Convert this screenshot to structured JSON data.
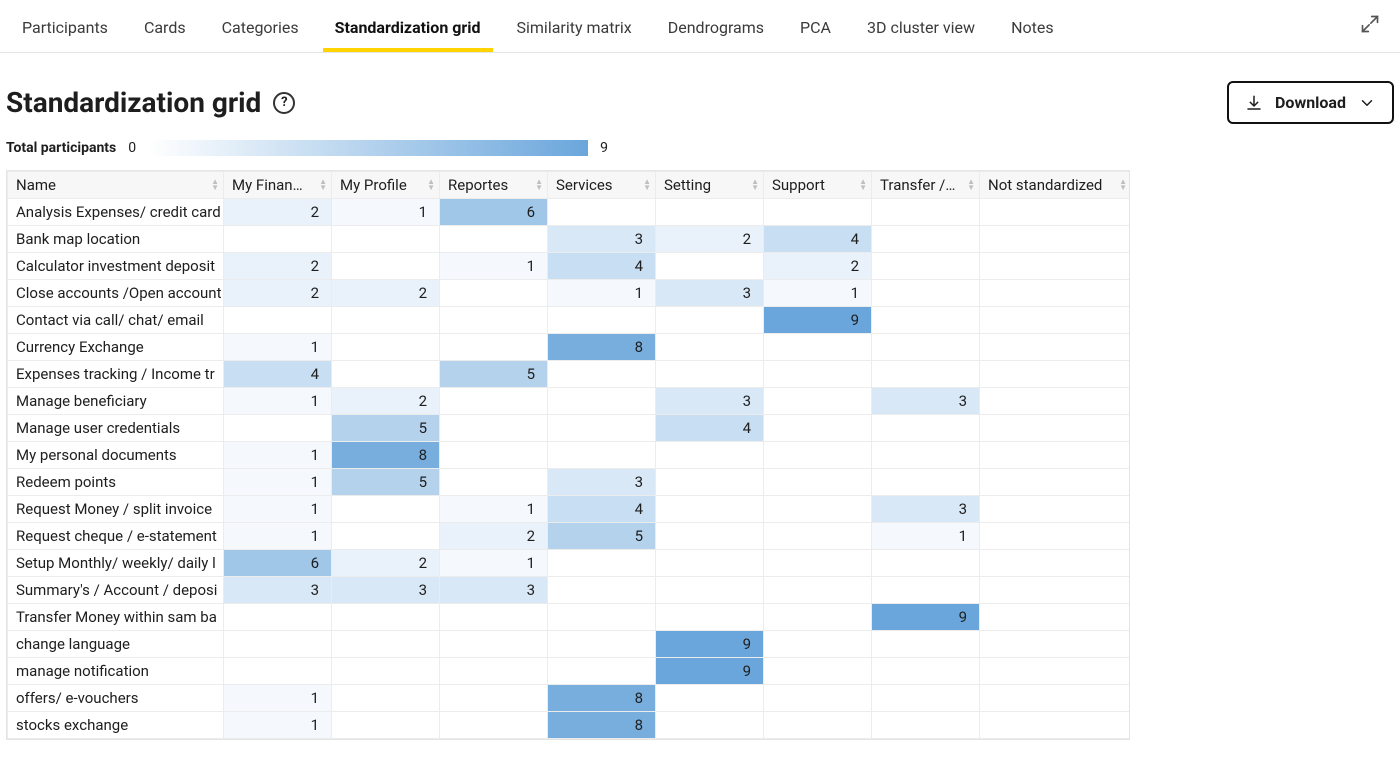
{
  "tabs": {
    "items": [
      "Participants",
      "Cards",
      "Categories",
      "Standardization grid",
      "Similarity matrix",
      "Dendrograms",
      "PCA",
      "3D cluster view",
      "Notes"
    ],
    "activeIndex": 3
  },
  "header": {
    "title": "Standardization grid",
    "download_label": "Download"
  },
  "legend": {
    "label": "Total participants",
    "min": "0",
    "max": "9",
    "maxValue": 9
  },
  "columns": [
    "Name",
    "My Finan…",
    "My Profile",
    "Reportes",
    "Services",
    "Setting",
    "Support",
    "Transfer /…",
    "Not standardized"
  ],
  "rows": [
    {
      "name": "Analysis Expenses/ credit card",
      "cells": [
        2,
        1,
        6,
        null,
        null,
        null,
        null,
        null
      ]
    },
    {
      "name": "Bank map location",
      "cells": [
        null,
        null,
        null,
        3,
        2,
        4,
        null,
        null
      ]
    },
    {
      "name": "Calculator investment deposit",
      "cells": [
        2,
        null,
        1,
        4,
        null,
        2,
        null,
        null
      ]
    },
    {
      "name": "Close accounts /Open account",
      "cells": [
        2,
        2,
        null,
        1,
        3,
        1,
        null,
        null
      ]
    },
    {
      "name": "Contact via call/ chat/ email",
      "cells": [
        null,
        null,
        null,
        null,
        null,
        9,
        null,
        null
      ]
    },
    {
      "name": "Currency Exchange",
      "cells": [
        1,
        null,
        null,
        8,
        null,
        null,
        null,
        null
      ]
    },
    {
      "name": "Expenses tracking / Income tr",
      "cells": [
        4,
        null,
        5,
        null,
        null,
        null,
        null,
        null
      ]
    },
    {
      "name": "Manage beneficiary",
      "cells": [
        1,
        2,
        null,
        null,
        3,
        null,
        3,
        null
      ]
    },
    {
      "name": "Manage user credentials",
      "cells": [
        null,
        5,
        null,
        null,
        4,
        null,
        null,
        null
      ]
    },
    {
      "name": "My personal documents",
      "cells": [
        1,
        8,
        null,
        null,
        null,
        null,
        null,
        null
      ]
    },
    {
      "name": "Redeem points",
      "cells": [
        1,
        5,
        null,
        3,
        null,
        null,
        null,
        null
      ]
    },
    {
      "name": "Request Money / split invoice",
      "cells": [
        1,
        null,
        1,
        4,
        null,
        null,
        3,
        null
      ]
    },
    {
      "name": "Request cheque / e-statement",
      "cells": [
        1,
        null,
        2,
        5,
        null,
        null,
        1,
        null
      ]
    },
    {
      "name": "Setup Monthly/ weekly/ daily l",
      "cells": [
        6,
        2,
        1,
        null,
        null,
        null,
        null,
        null
      ]
    },
    {
      "name": "Summary's / Account / deposi",
      "cells": [
        3,
        3,
        3,
        null,
        null,
        null,
        null,
        null
      ]
    },
    {
      "name": "Transfer Money within sam ba",
      "cells": [
        null,
        null,
        null,
        null,
        null,
        null,
        9,
        null
      ]
    },
    {
      "name": "change language",
      "cells": [
        null,
        null,
        null,
        null,
        9,
        null,
        null,
        null
      ]
    },
    {
      "name": "manage notification",
      "cells": [
        null,
        null,
        null,
        null,
        9,
        null,
        null,
        null
      ]
    },
    {
      "name": "offers/ e-vouchers",
      "cells": [
        1,
        null,
        null,
        8,
        null,
        null,
        null,
        null
      ]
    },
    {
      "name": "stocks exchange",
      "cells": [
        1,
        null,
        null,
        8,
        null,
        null,
        null,
        null
      ]
    }
  ],
  "heat_colors": [
    "#ffffff",
    "#f5f9fd",
    "#e9f1fa",
    "#d9e8f6",
    "#c8def2",
    "#b5d2ed",
    "#a0c6e8",
    "#8bb9e3",
    "#78aede",
    "#6aa6dc"
  ]
}
